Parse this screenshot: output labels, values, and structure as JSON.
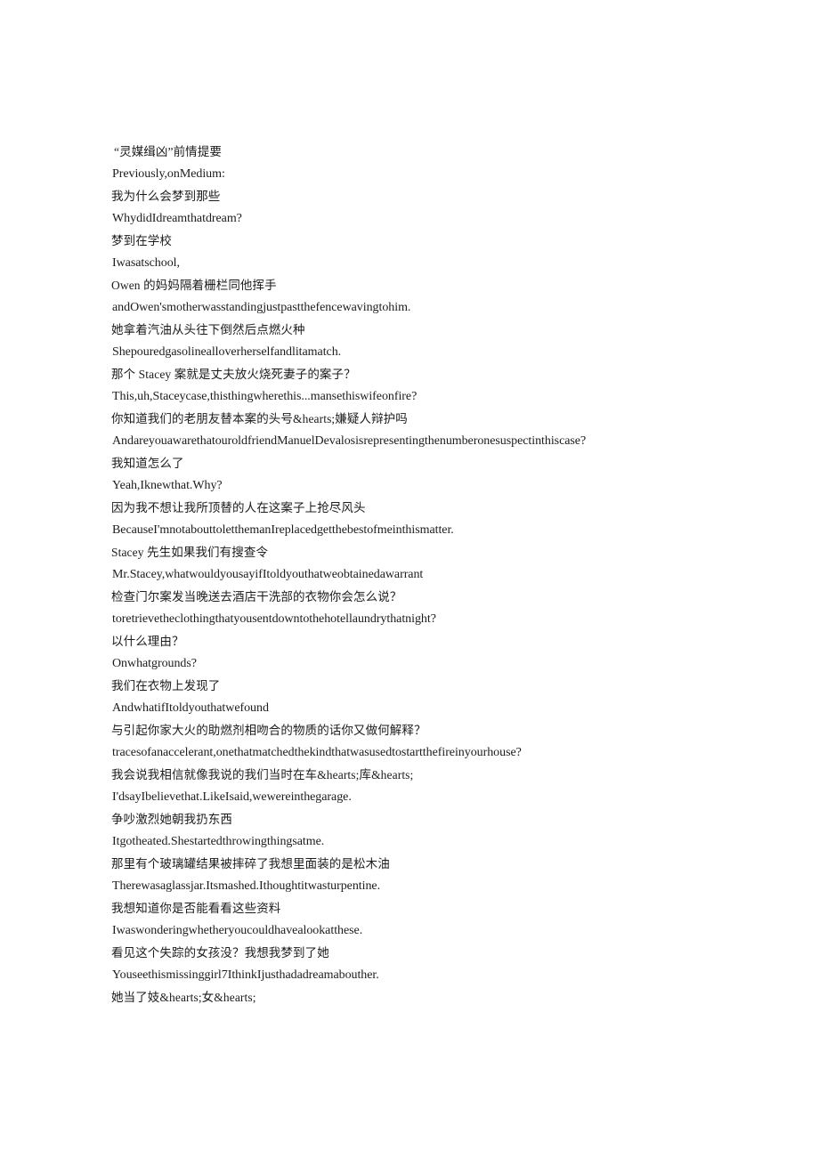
{
  "document": {
    "page_background": "#ffffff",
    "text_color": "#1c1c1c",
    "title_line": "“灵媒缉凶”前情提要",
    "lines": [
      {
        "lang": "zh",
        "text": "“灵媒缉凶”前情提要"
      },
      {
        "lang": "en",
        "text": "Previously,onMedium:"
      },
      {
        "lang": "zh",
        "text": "我为什么会梦到那些"
      },
      {
        "lang": "en",
        "text": "WhydidIdreamthatdream?"
      },
      {
        "lang": "zh",
        "text": "梦到在学校"
      },
      {
        "lang": "en",
        "text": "Iwasatschool,"
      },
      {
        "lang": "zh",
        "text": "Owen 的妈妈隔着栅栏同他挥手"
      },
      {
        "lang": "en",
        "text": "andOwen'smotherwasstandingjustpastthefencewavingtohim."
      },
      {
        "lang": "zh",
        "text": "她拿着汽油从头往下倒然后点燃火种"
      },
      {
        "lang": "en",
        "text": "Shepouredgasolinealloverherselfandlitamatch."
      },
      {
        "lang": "zh",
        "text": "那个 Stacey 案就是丈夫放火烧死妻子的案子？"
      },
      {
        "lang": "en",
        "text": "This,uh,Staceycase,thisthingwherethis...mansethiswifeonfire?"
      },
      {
        "lang": "zh",
        "text": "你知道我们的老朋友替本案的头号&hearts;嫌疑人辩护吗"
      },
      {
        "lang": "en",
        "text": "AndareyouawarethatouroldfriendManuelDevalosisrepresentingthenumberonesuspectinthiscase?"
      },
      {
        "lang": "zh",
        "text": "我知道怎么了"
      },
      {
        "lang": "en",
        "text": "Yeah,Iknewthat.Why?"
      },
      {
        "lang": "zh",
        "text": "因为我不想让我所顶替的人在这案子上抢尽风头"
      },
      {
        "lang": "en",
        "text": "BecauseI'mnotabouttoletthemanIreplacedgetthebestofmeinthismatter."
      },
      {
        "lang": "zh",
        "text": "Stacey 先生如果我们有搜查令"
      },
      {
        "lang": "en",
        "text": "Mr.Stacey,whatwouldyousayifItoldyouthatweobtainedawarrant"
      },
      {
        "lang": "zh",
        "text": "检查门尔案发当晚送去酒店干洗部的衣物你会怎么说？"
      },
      {
        "lang": "en",
        "text": "toretrievetheclothingthatyousentdowntothehotellaundrythatnight?"
      },
      {
        "lang": "zh",
        "text": "以什么理由？"
      },
      {
        "lang": "en",
        "text": "Onwhatgrounds?"
      },
      {
        "lang": "zh",
        "text": "我们在衣物上发现了"
      },
      {
        "lang": "en",
        "text": "AndwhatifItoldyouthatwefound"
      },
      {
        "lang": "zh",
        "text": "与引起你家大火的助燃剂相吻合的物质的话你又做何解释？"
      },
      {
        "lang": "en",
        "text": "tracesofanaccelerant,onethatmatchedthekindthatwasusedtostartthefireinyourhouse?"
      },
      {
        "lang": "zh",
        "text": "我会说我相信就像我说的我们当时在车&hearts;库&hearts;"
      },
      {
        "lang": "en",
        "text": "I'dsayIbelievethat.LikeIsaid,wewereinthegarage."
      },
      {
        "lang": "zh",
        "text": "争吵激烈她朝我扔东西"
      },
      {
        "lang": "en",
        "text": "Itgotheated.Shestartedthrowingthingsatme."
      },
      {
        "lang": "zh",
        "text": "那里有个玻璃罐结果被摔碎了我想里面装的是松木油"
      },
      {
        "lang": "en",
        "text": "Therewasaglassjar.Itsmashed.Ithoughtitwasturpentine."
      },
      {
        "lang": "zh",
        "text": "我想知道你是否能看看这些资料"
      },
      {
        "lang": "en",
        "text": "Iwaswonderingwhetheryoucouldhavealookatthese."
      },
      {
        "lang": "zh",
        "text": "看见这个失踪的女孩没？我想我梦到了她"
      },
      {
        "lang": "en",
        "text": "Youseethismissinggirl7IthinkIjusthadadreamabouther."
      },
      {
        "lang": "zh",
        "text": "她当了妓&hearts;女&hearts;"
      }
    ]
  }
}
